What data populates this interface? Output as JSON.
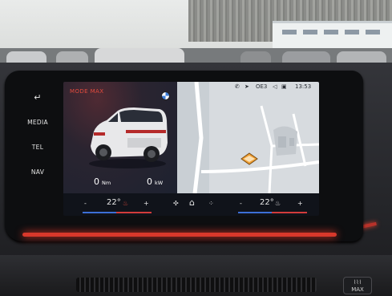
{
  "sidebar": {
    "items": [
      {
        "label": "↵",
        "icon": "back-arrow-icon"
      },
      {
        "label": "MEDIA"
      },
      {
        "label": "TEL"
      },
      {
        "label": "NAV"
      }
    ]
  },
  "screen": {
    "mode_label": "MODE MAX",
    "torque": {
      "value": "0",
      "unit": "Nm"
    },
    "power": {
      "value": "0",
      "unit": "kW"
    },
    "status": {
      "clock": "13:53",
      "signal": "OE3",
      "icons": [
        "phone-icon",
        "location-icon",
        "volume-icon",
        "radio-icon"
      ]
    }
  },
  "climate": {
    "minus_left": "-",
    "temp_left": "22°",
    "plus_left": "+",
    "minus_right": "-",
    "temp_right": "22°",
    "plus_right": "+",
    "icons": [
      "seat-heat-icon",
      "fan-icon",
      "home-icon",
      "apps-grid-icon",
      "seat-heat-icon"
    ]
  },
  "car_badge": {
    "max_label": "MAX"
  },
  "colors": {
    "accent_red": "#e34b3d",
    "ambient_light": "#d8382b",
    "temp_bar_red": "#d23b3b",
    "temp_bar_blue": "#3d6fd6"
  }
}
